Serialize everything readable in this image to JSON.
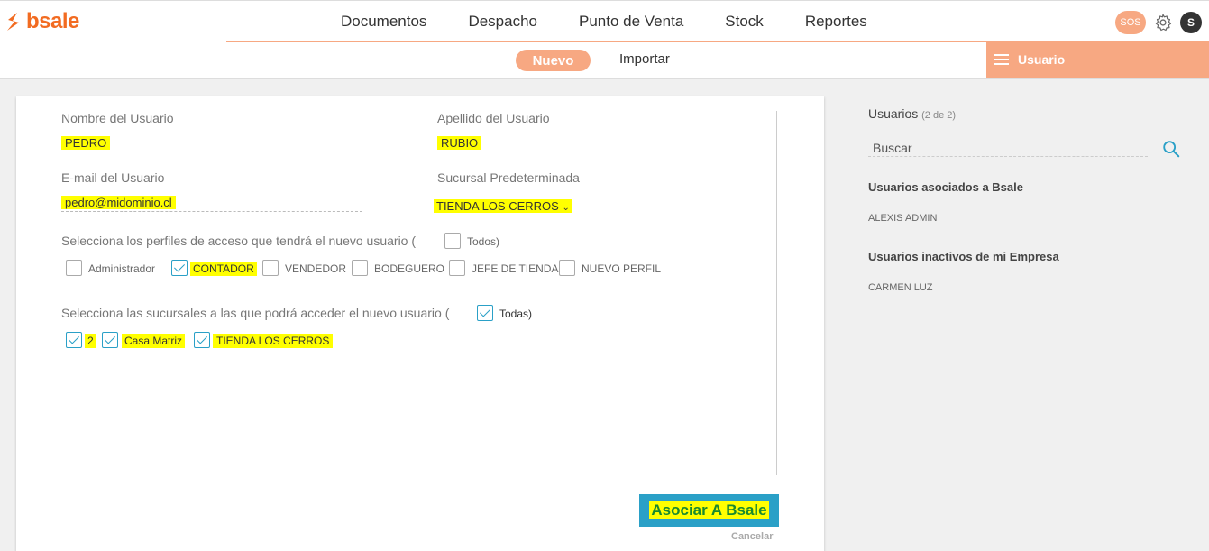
{
  "brand": {
    "logo_text": "bsale",
    "accent": "#f26b21",
    "soft_accent": "#f7a882"
  },
  "nav": {
    "items": [
      "Documentos",
      "Despacho",
      "Punto de Venta",
      "Stock",
      "Reportes"
    ],
    "sos_label": "SOS",
    "settings_icon": "gear-icon",
    "avatar_letter": "S"
  },
  "subnav": {
    "nuevo": "Nuevo",
    "importar": "Importar",
    "usuario_tab": "Usuario"
  },
  "form": {
    "nombre_label": "Nombre del Usuario",
    "nombre_value": "PEDRO",
    "apellido_label": "Apellido del Usuario",
    "apellido_value": "RUBIO",
    "email_label": "E-mail del Usuario",
    "email_value": "pedro@midominio.cl",
    "sucursal_label": "Sucursal Predeterminada",
    "sucursal_value": "TIENDA LOS CERROS",
    "perfiles_label": "Selecciona los perfiles de acceso que tendrá el nuevo usuario (",
    "perfiles_todos": "Todos)",
    "perfiles": [
      {
        "label": "Administrador",
        "checked": false
      },
      {
        "label": "CONTADOR",
        "checked": true
      },
      {
        "label": "VENDEDOR",
        "checked": false
      },
      {
        "label": "BODEGUERO",
        "checked": false
      },
      {
        "label": "JEFE DE TIENDA",
        "checked": false
      },
      {
        "label": "NUEVO PERFIL",
        "checked": false
      }
    ],
    "sucursales_label": "Selecciona las sucursales a las que podrá acceder el nuevo usuario (",
    "sucursales_todas": "Todas)",
    "sucursales": [
      {
        "label": "2",
        "checked": true
      },
      {
        "label": "Casa Matriz",
        "checked": true
      },
      {
        "label": "TIENDA LOS CERROS",
        "checked": true
      }
    ],
    "submit": "Asociar A Bsale",
    "cancel": "Cancelar"
  },
  "panel": {
    "title": "Usuarios",
    "count": "(2 de 2)",
    "search_placeholder": "Buscar",
    "asociados_heading": "Usuarios asociados a Bsale",
    "asociados": [
      "ALEXIS ADMIN"
    ],
    "inactivos_heading": "Usuarios inactivos de mi Empresa",
    "inactivos": [
      "CARMEN LUZ"
    ]
  }
}
